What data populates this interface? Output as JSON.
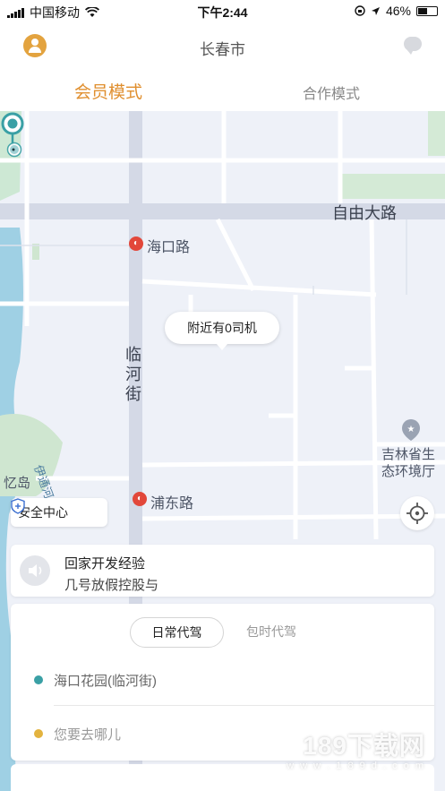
{
  "status_bar": {
    "carrier": "中国移动",
    "time": "下午2:44",
    "battery": "46%"
  },
  "header": {
    "city": "长春市",
    "avatar_icon": "user-avatar-icon",
    "message_icon": "chat-bubble-icon"
  },
  "mode_tabs": {
    "member": "会员模式",
    "cooperation": "合作模式",
    "active_color": "#e08f2f"
  },
  "map": {
    "roads": {
      "ziyou": "自由大路",
      "linhe_1": "临",
      "linhe_2": "河",
      "linhe_3": "街"
    },
    "metro_stations": {
      "haikou": "海口路",
      "pudong": "浦东路"
    },
    "places": {
      "env_office_line1": "吉林省生",
      "env_office_line2": "态环境厅",
      "yidao": "忆岛",
      "yitong_river": "伊通河"
    },
    "driver_bubble": "附近有0司机",
    "safety_center": "安全中心"
  },
  "notice": {
    "title": "回家开发经验",
    "subtitle": "几号放假控股与"
  },
  "booking": {
    "tabs": [
      "日常代驾",
      "包时代驾"
    ],
    "pickup": "海口花园(临河街)",
    "destination_placeholder": "您要去哪儿",
    "pickup_color": "#3aa0a5",
    "destination_color": "#e3b33f"
  },
  "watermark": {
    "main": "189下载网",
    "url": "w w w . 1 8 9 d . c o m"
  }
}
